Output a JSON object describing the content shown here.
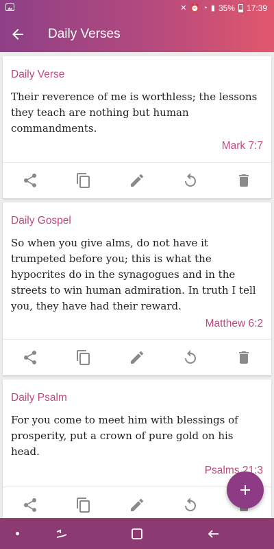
{
  "status_bar": {
    "battery": "35%",
    "time": "17:39"
  },
  "app_bar": {
    "title": "Daily Verses"
  },
  "cards": [
    {
      "title": "Daily Verse",
      "text": "Their reverence of me is worthless; the lessons they teach are nothing but human commandments.",
      "reference": "Mark 7:7"
    },
    {
      "title": "Daily Gospel",
      "text": "So when you give alms, do not have it trumpeted before you; this is what the hypocrites do in the synagogues and in the streets to win human admiration. In truth I tell you, they have had their reward.",
      "reference": "Matthew 6:2"
    },
    {
      "title": "Daily Psalm",
      "text": "For you come to meet him with blessings of prosperity, put a crown of pure gold on his head.",
      "reference": "Psalms 21:3"
    }
  ],
  "icons": [
    "share-icon",
    "copy-icon",
    "edit-icon",
    "refresh-icon",
    "delete-icon",
    "add-icon",
    "back-arrow-icon"
  ],
  "colors": {
    "accent": "#c2477d",
    "bar_start": "#8d3f86",
    "bar_end": "#e0576c",
    "fab": "#8c3b84",
    "nav": "#8c3b72"
  }
}
